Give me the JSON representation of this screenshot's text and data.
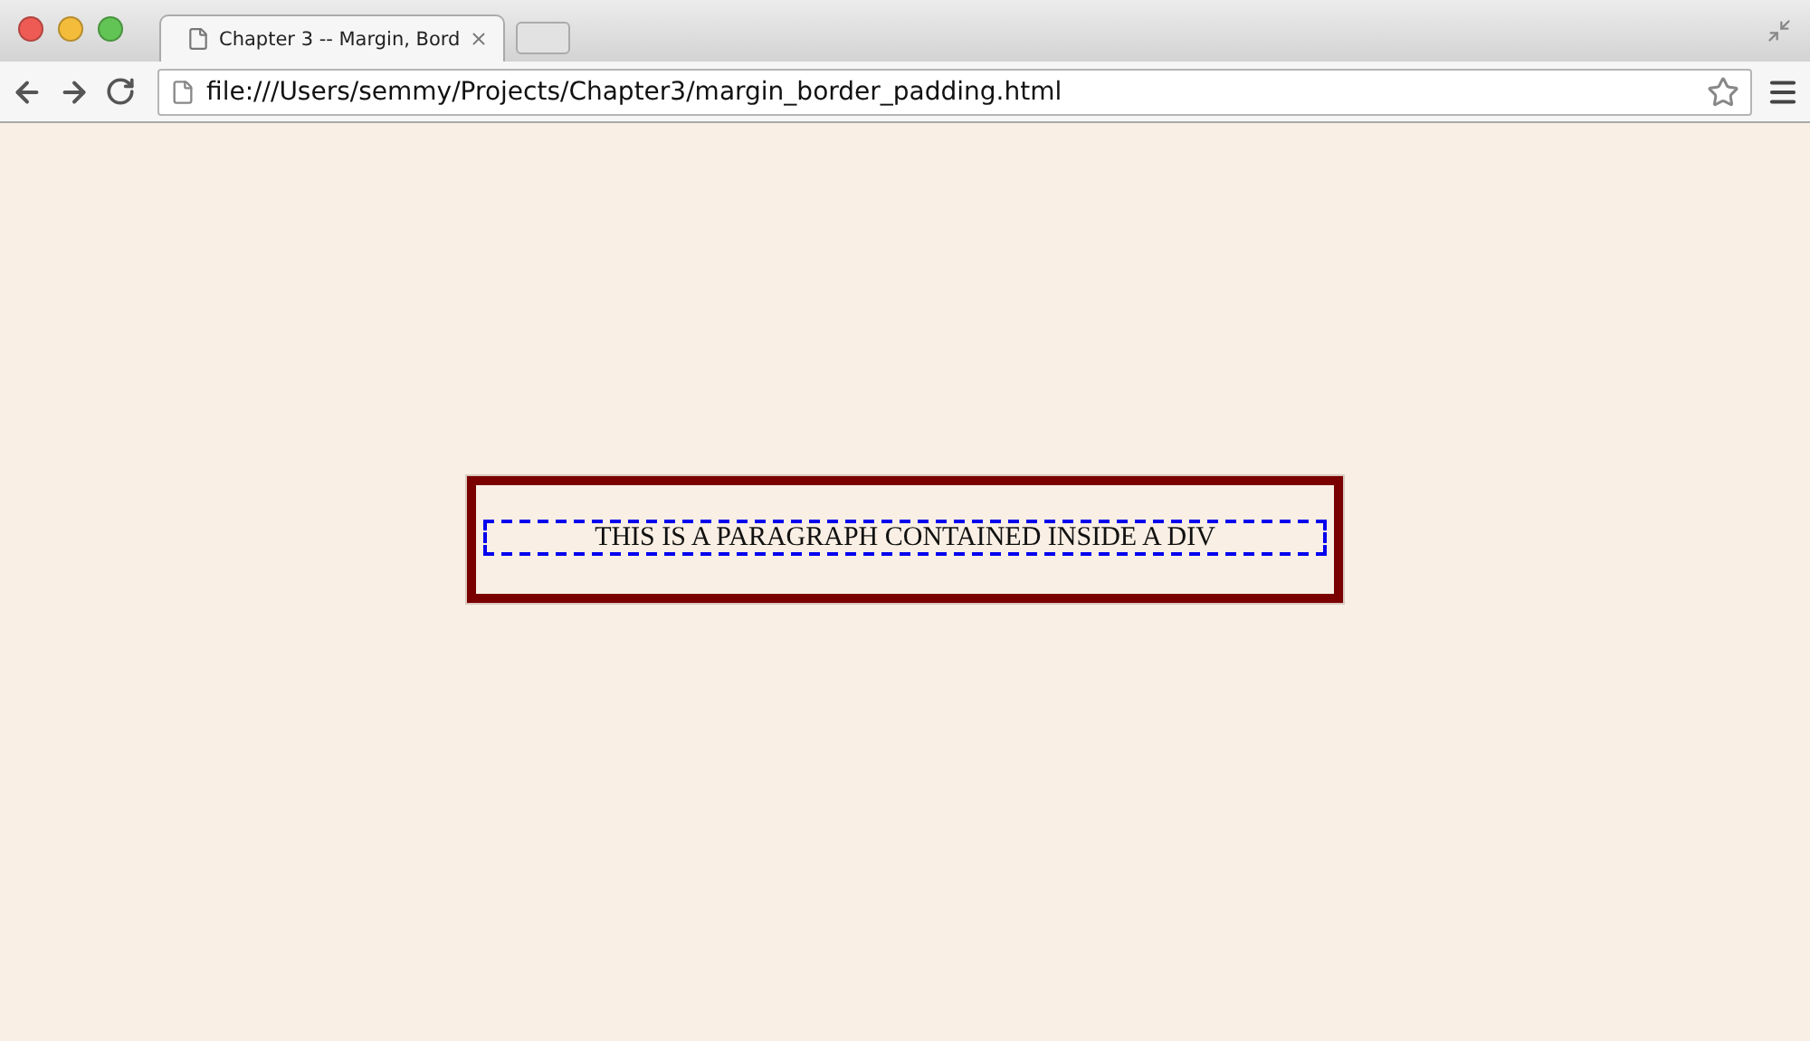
{
  "tabs": [
    {
      "title": "Chapter 3 -- Margin, Bord",
      "selected": true
    }
  ],
  "address_bar": {
    "url": "file:///Users/semmy/Projects/Chapter3/margin_border_padding.html"
  },
  "page": {
    "paragraph": "THIS IS A PARAGRAPH CONTAINED INSIDE A DIV"
  }
}
